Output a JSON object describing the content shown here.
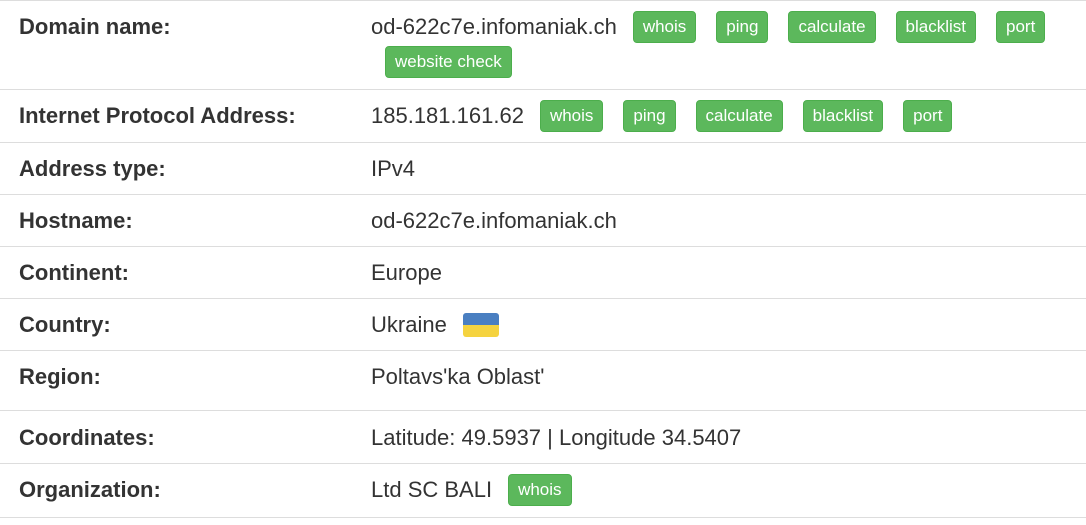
{
  "rows": {
    "domain": {
      "label": "Domain name:",
      "value": "od-622c7e.infomaniak.ch",
      "buttons": [
        "whois",
        "ping",
        "calculate",
        "blacklist",
        "port",
        "website check"
      ]
    },
    "ip": {
      "label": "Internet Protocol Address:",
      "value": "185.181.161.62",
      "buttons": [
        "whois",
        "ping",
        "calculate",
        "blacklist",
        "port"
      ]
    },
    "address_type": {
      "label": "Address type:",
      "value": "IPv4"
    },
    "hostname": {
      "label": "Hostname:",
      "value": "od-622c7e.infomaniak.ch"
    },
    "continent": {
      "label": "Continent:",
      "value": "Europe"
    },
    "country": {
      "label": "Country:",
      "value": "Ukraine",
      "flag_colors": [
        "#4a7fc1",
        "#f5d33f"
      ]
    },
    "region": {
      "label": "Region:",
      "value": "Poltavs'ka Oblast'"
    },
    "coordinates": {
      "label": "Coordinates:",
      "value": "Latitude: 49.5937 | Longitude 34.5407"
    },
    "organization": {
      "label": "Organization:",
      "value": "Ltd SC BALI",
      "buttons": [
        "whois"
      ]
    }
  },
  "colors": {
    "button_green": "#5cb85c",
    "border": "#dddddd",
    "text": "#333333"
  }
}
